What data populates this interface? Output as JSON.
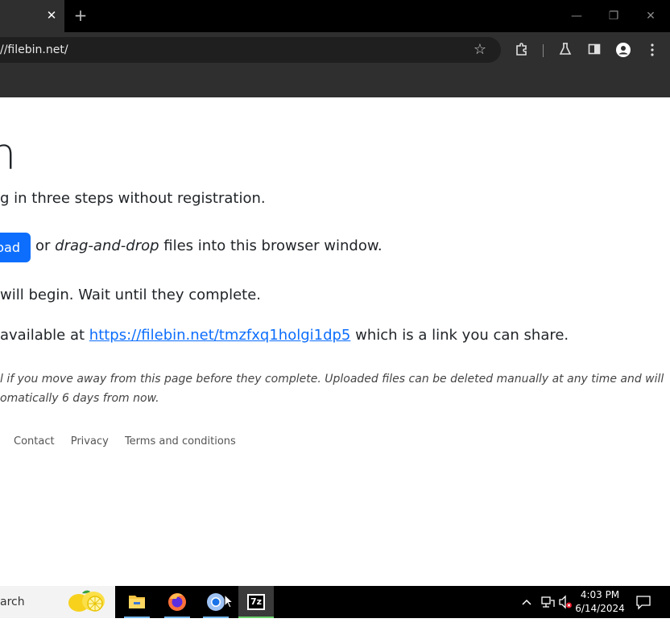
{
  "browser": {
    "tab_close_glyph": "✕",
    "new_tab_glyph": "+",
    "window_controls": {
      "minimize": "—",
      "restore": "❐",
      "close": "✕"
    },
    "url": "//filebin.net/",
    "icons": [
      "star-icon",
      "extensions-icon",
      "labs-icon",
      "side-panel-icon",
      "profile-icon",
      "menu-icon"
    ]
  },
  "page": {
    "title_fragment": "n",
    "line1": "g in three steps without registration.",
    "upload_button_label": "oad",
    "line2_or": " or ",
    "line2_italic": "drag-and-drop",
    "line2_rest": " files into this browser window.",
    "line3": " will begin. Wait until they complete.",
    "line4_prefix": "available at ",
    "line4_link": "https://filebin.net/tmzfxq1holgi1dp5",
    "line4_suffix": " which is a link you can share.",
    "note_line1": "l if you move away from this page before they complete. Uploaded files can be deleted manually at any time and will",
    "note_line2": "omatically 6 days from now.",
    "footer": {
      "contact": "Contact",
      "privacy": "Privacy",
      "terms": "Terms and conditions"
    },
    "link_color": "#0d6efd",
    "button_color": "#0d6efd"
  },
  "taskbar": {
    "search_text": "arch",
    "apps": [
      "file-explorer-icon",
      "firefox-icon",
      "chrome-icon",
      "7zip-icon"
    ],
    "sevenzip_label": "7z",
    "tray_chevron": "^",
    "time": "4:03 PM",
    "date": "6/14/2024"
  }
}
